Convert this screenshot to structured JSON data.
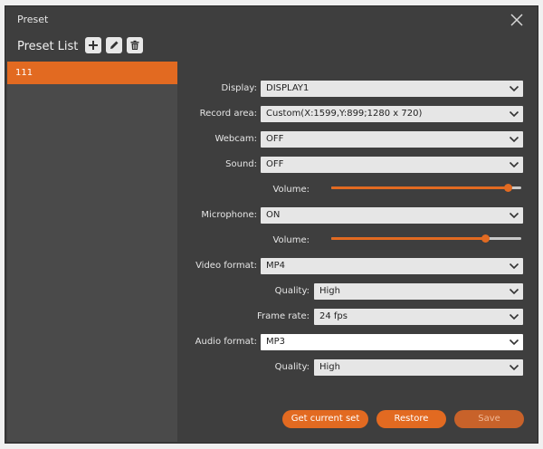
{
  "window": {
    "title": "Preset"
  },
  "preset_list": {
    "title": "Preset List",
    "items": [
      {
        "label": "111"
      }
    ]
  },
  "form": {
    "display": {
      "label": "Display:",
      "value": "DISPLAY1"
    },
    "record_area": {
      "label": "Record area:",
      "value": "Custom(X:1599,Y:899;1280 x 720)"
    },
    "webcam": {
      "label": "Webcam:",
      "value": "OFF"
    },
    "sound": {
      "label": "Sound:",
      "value": "OFF"
    },
    "sound_volume": {
      "label": "Volume:",
      "level": 0.93
    },
    "microphone": {
      "label": "Microphone:",
      "value": "ON"
    },
    "mic_volume": {
      "label": "Volume:",
      "level": 0.81
    },
    "video_format": {
      "label": "Video format:",
      "value": "MP4"
    },
    "video_quality": {
      "label": "Quality:",
      "value": "High"
    },
    "frame_rate": {
      "label": "Frame rate:",
      "value": "24 fps"
    },
    "audio_format": {
      "label": "Audio format:",
      "value": "MP3"
    },
    "audio_quality": {
      "label": "Quality:",
      "value": "High"
    }
  },
  "buttons": {
    "get_current": "Get current set",
    "restore": "Restore",
    "save": "Save"
  },
  "colors": {
    "accent": "#e26a21",
    "background": "#3e3e3e",
    "sidebar": "#4a4a4a"
  },
  "icons": [
    "close-icon",
    "plus-icon",
    "pencil-icon",
    "trash-icon",
    "chevron-down-icon"
  ]
}
